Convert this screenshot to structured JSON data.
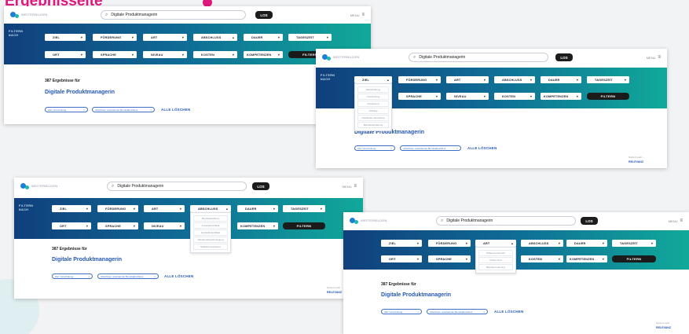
{
  "heading": "Ergebnisseite",
  "logo_text": "WEITERBILDEN",
  "search_value": "Digitale Produktmanagerin",
  "go_label": "LOS",
  "menu_label": "MENU",
  "filter_label": "FILTERN NACH",
  "filters": {
    "ziel": "ZIEL",
    "foerderung": "FÖRDERUNG",
    "art": "ART",
    "abschluss": "ABSCHLUSS",
    "dauer": "DAUER",
    "tageszeit": "TAGESZEIT",
    "ort": "ORT",
    "sprache": "SPRACHE",
    "niveau": "NIVEAU",
    "kosten": "KOSTEN",
    "kompetenzen": "KOMPETENZEN",
    "filtern": "FILTERN"
  },
  "results": {
    "count": "387 Ergebnisse für",
    "query": "Digitale Produktmanagerin",
    "chip1": "Ziel: Umschulung",
    "chip2": "Abschluss: anerkannter Berufsabschluss",
    "clear": "ALLE LÖSCHEN",
    "sort_label": "Sortiert nach",
    "sort_value": "RELEVANZ"
  },
  "ziel_options": [
    "Weiterbildung",
    "Umschulung",
    "Anpassung",
    "Aufstieg",
    "Nachholen Abschluss",
    "Berufsorientierung"
  ],
  "abschluss_options": [
    "Berufsabschluss",
    "Industriezertifikat",
    "Herstellerzertifikat",
    "Teilnahmebescheinigung",
    "Staatlich anerkannt"
  ],
  "art_options": [
    "Präsenzunterricht",
    "Online Kurs",
    "Blended Learning"
  ],
  "icons": {
    "search": "search-icon",
    "menu": "hamburger-menu-icon",
    "chevron": "chevron-down-icon"
  },
  "colors": {
    "accent": "#e0187e",
    "band_start": "#103f7c",
    "band_end": "#11a99a",
    "link": "#2458b4"
  }
}
